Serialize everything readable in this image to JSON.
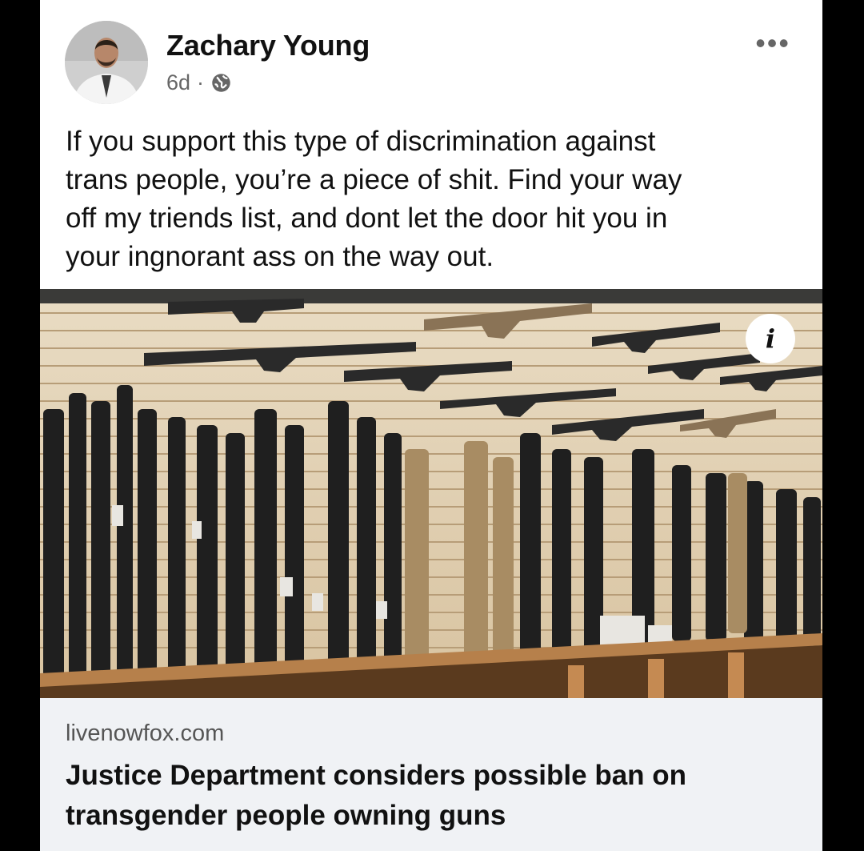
{
  "post": {
    "author": "Zachary Young",
    "time": "6d",
    "separator": "·",
    "privacy_icon": "globe-icon",
    "more_label": "•••",
    "text": "If you support this type of discrimination against\ntrans people, you’re a piece of shit. Find your way\noff my triends list, and dont let the door hit you in\nyour ingnorant ass on the way out."
  },
  "link_preview": {
    "domain": "livenowfox.com",
    "headline": "Justice Department considers possible ban on transgender people owning guns",
    "info_icon": "info-icon",
    "info_label": "i"
  },
  "colors": {
    "page_background": "#000000",
    "card_background": "#ffffff",
    "link_box_background": "#f0f2f5",
    "text": "#111111",
    "muted": "#666666"
  }
}
